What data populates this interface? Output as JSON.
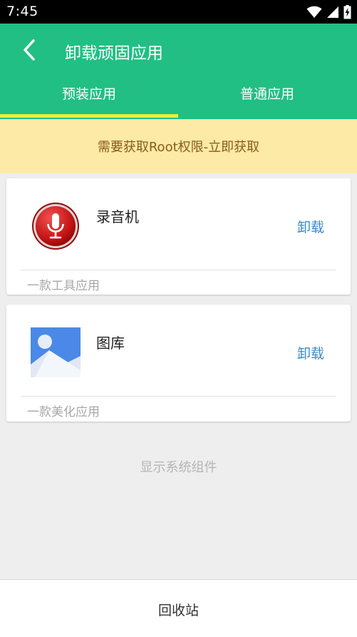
{
  "status_bar": {
    "time": "7:45",
    "icons": [
      "wifi-icon",
      "signal-icon",
      "battery-charging-icon"
    ]
  },
  "header": {
    "back_icon": "back-arrow-icon",
    "title": "卸载顽固应用",
    "background_color": "#21bf84"
  },
  "tabs": [
    {
      "label": "预装应用",
      "selected": true
    },
    {
      "label": "普通应用",
      "selected": false
    }
  ],
  "tab_indicator_color": "#e8ee3a",
  "root_banner": {
    "text": "需要获取Root权限-立即获取",
    "background_color": "#fdeaa6"
  },
  "apps": [
    {
      "name": "录音机",
      "icon": "microphone-icon",
      "description": "一款工具应用",
      "action_label": "卸载"
    },
    {
      "name": "图库",
      "icon": "gallery-icon",
      "description": "一款美化应用",
      "action_label": "卸载"
    }
  ],
  "show_system_label": "显示系统组件",
  "bottom_bar": {
    "recycle_label": "回收站"
  },
  "accent_color": "#3f88c6"
}
